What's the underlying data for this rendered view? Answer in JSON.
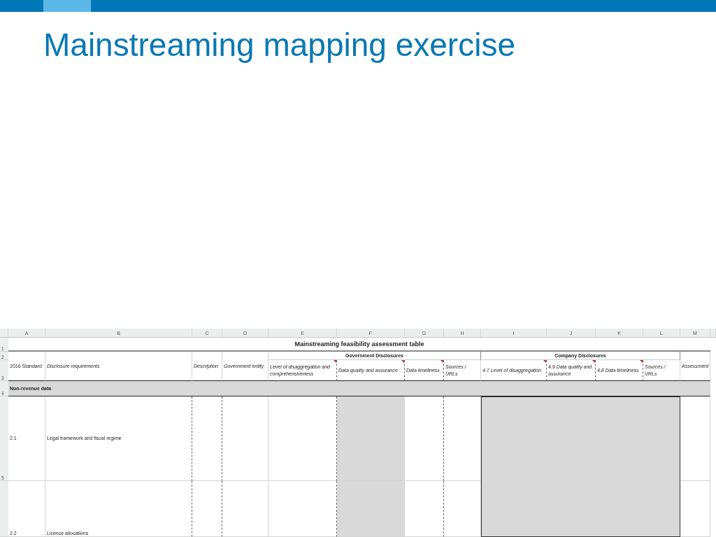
{
  "slide": {
    "title": "Mainstreaming mapping exercise"
  },
  "sheet": {
    "columns": [
      "A",
      "B",
      "C",
      "D",
      "E",
      "F",
      "G",
      "H",
      "I",
      "J",
      "K",
      "L",
      "M"
    ],
    "row_numbers": [
      "1",
      "2",
      "3",
      "4",
      "5"
    ],
    "table_title": "Mainstreaming feasibility assessment table",
    "groups": [
      {
        "label": "Government Disclosures"
      },
      {
        "label": "Company Disclosures"
      }
    ],
    "headers": [
      {
        "label": "2016 Standard",
        "comment": false
      },
      {
        "label": "Disclosure requirements",
        "comment": false
      },
      {
        "label": "Description",
        "comment": false
      },
      {
        "label": "Government entity",
        "comment": false
      },
      {
        "label": "Level of disaggregation and comprehensiveness",
        "comment": true
      },
      {
        "label": "Data quality and assurance",
        "comment": true
      },
      {
        "label": "Data timeliness",
        "comment": true
      },
      {
        "label": "Sources / URLs",
        "comment": false
      },
      {
        "label": "4.7 Level of disaggregation",
        "comment": true
      },
      {
        "label": "4.9 Data quality and assurance",
        "comment": true
      },
      {
        "label": "4.8 Data timeliness",
        "comment": true
      },
      {
        "label": "Sources / URLs",
        "comment": false
      },
      {
        "label": "Assessment",
        "comment": false
      }
    ],
    "section": "Non-revenue data",
    "rows": [
      {
        "code": "2.1",
        "requirement": "Legal framework and fiscal regime"
      },
      {
        "code": "2.2",
        "requirement": "Licence allocations"
      }
    ]
  }
}
